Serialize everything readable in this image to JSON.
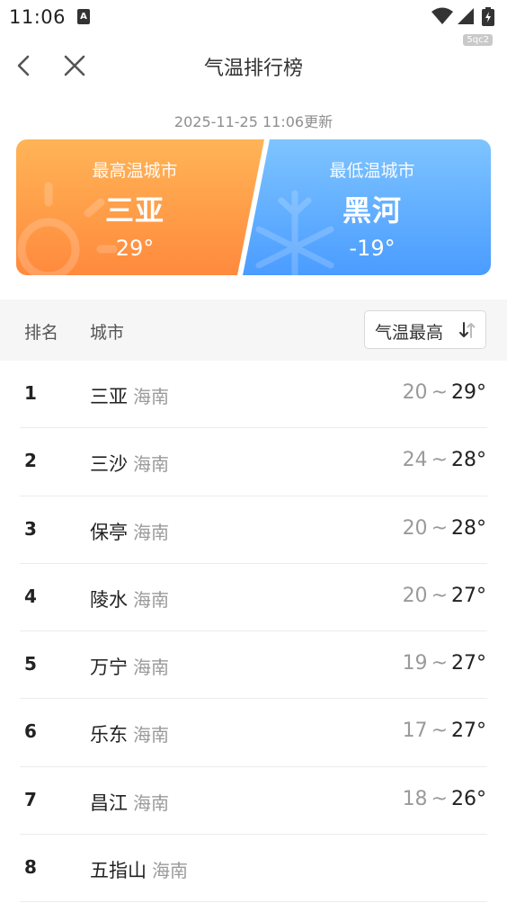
{
  "status": {
    "time": "11:06",
    "app_badge": "A"
  },
  "watermark": "5qc2",
  "nav": {
    "title": "气温排行榜"
  },
  "update_time": "2025-11-25 11:06更新",
  "highest": {
    "label": "最高温城市",
    "city": "三亚",
    "temp": "29°"
  },
  "lowest": {
    "label": "最低温城市",
    "city": "黑河",
    "temp": "-19°"
  },
  "colors": {
    "hot_start": "#ffb457",
    "hot_end": "#ff8a3d",
    "cold_start": "#7ec4ff",
    "cold_end": "#4a9cff"
  },
  "table": {
    "col_rank": "排名",
    "col_city": "城市",
    "sort_label": "气温最高",
    "rows": [
      {
        "rank": "1",
        "city": "三亚",
        "province": "海南",
        "low": "20",
        "sep": "~",
        "high": "29°"
      },
      {
        "rank": "2",
        "city": "三沙",
        "province": "海南",
        "low": "24",
        "sep": "~",
        "high": "28°"
      },
      {
        "rank": "3",
        "city": "保亭",
        "province": "海南",
        "low": "20",
        "sep": "~",
        "high": "28°"
      },
      {
        "rank": "4",
        "city": "陵水",
        "province": "海南",
        "low": "20",
        "sep": "~",
        "high": "27°"
      },
      {
        "rank": "5",
        "city": "万宁",
        "province": "海南",
        "low": "19",
        "sep": "~",
        "high": "27°"
      },
      {
        "rank": "6",
        "city": "乐东",
        "province": "海南",
        "low": "17",
        "sep": "~",
        "high": "27°"
      },
      {
        "rank": "7",
        "city": "昌江",
        "province": "海南",
        "low": "18",
        "sep": "~",
        "high": "26°"
      },
      {
        "rank": "8",
        "city": "五指山",
        "province": "海南",
        "low": "",
        "sep": "",
        "high": ""
      }
    ]
  }
}
